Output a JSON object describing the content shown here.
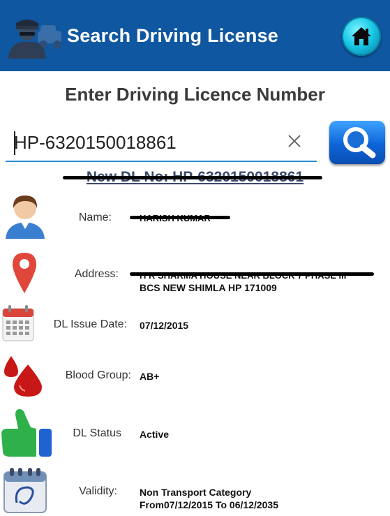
{
  "header": {
    "title": "Search Driving License",
    "logo_icon": "police-officer-icon",
    "home_icon": "home-icon",
    "bg_color": "#0f57a0"
  },
  "subtitle": "Enter Driving Licence Number",
  "search": {
    "value": "HP-6320150018861",
    "clear_icon": "close-icon",
    "button_icon": "search-icon"
  },
  "new_dl": "New DL No: HP-6320150018861",
  "fields": {
    "name": {
      "label": "Name:",
      "value": "HARISH KUMAR",
      "icon": "person-icon"
    },
    "address": {
      "label": "Address:",
      "value_line1": "H R SHARMA HOUSE NEAR BLOCK 7 PHASE III",
      "value_line2": "BCS NEW SHIMLA HP 171009",
      "icon": "location-pin-icon"
    },
    "issue_date": {
      "label": "DL Issue Date:",
      "value": "07/12/2015",
      "icon": "calendar-icon"
    },
    "blood_group": {
      "label": "Blood Group:",
      "value": "AB+",
      "icon": "blood-drop-icon"
    },
    "status": {
      "label": "DL Status",
      "value": "Active",
      "icon": "thumbs-up-icon"
    },
    "validity": {
      "label": "Validity:",
      "value_line1": "Non Transport Category",
      "value_line2": "From07/12/2015 To 06/12/2035",
      "icon": "calendar-validity-icon"
    }
  }
}
